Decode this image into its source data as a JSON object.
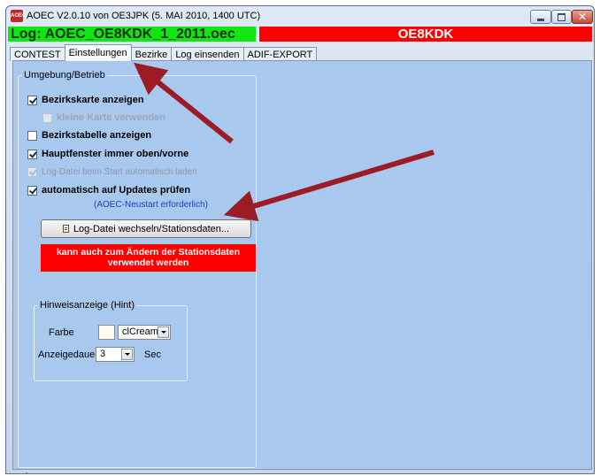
{
  "window": {
    "app_icon_text": "AOEC",
    "title": "AOEC V2.0.10 von OE3JPK (5. MAI 2010, 1400 UTC)",
    "close_glyph": "✕"
  },
  "header": {
    "log_label": "Log: AOEC_OE8KDK_1_2011.oec",
    "callsign": "OE8KDK"
  },
  "tabs": [
    {
      "label": "CONTEST"
    },
    {
      "label": "Einstellungen"
    },
    {
      "label": "Bezirke"
    },
    {
      "label": "Log einsenden"
    },
    {
      "label": "ADIF-EXPORT"
    }
  ],
  "environment": {
    "legend": "Umgebung/Betrieb",
    "options": [
      {
        "label": "Bezirkskarte anzeigen",
        "checked": true,
        "enabled": true
      },
      {
        "label": "kleine Karte verwenden",
        "checked": false,
        "enabled": false
      },
      {
        "label": "Bezirkstabelle anzeigen",
        "checked": false,
        "enabled": true
      },
      {
        "label": "Hauptfenster immer oben/vorne",
        "checked": true,
        "enabled": true
      },
      {
        "label": "Log-Datei beim Start automatisch laden",
        "checked": true,
        "enabled": false
      },
      {
        "label": "automatisch auf Updates prüfen",
        "checked": true,
        "enabled": true
      }
    ],
    "restart_note": "(AOEC-Neustart erforderlich)",
    "switch_button": "Log-Datei wechseln/Stationsdaten...",
    "red_note_line1": "kann auch zum Ändern der Stationsdaten",
    "red_note_line2": "verwendet werden"
  },
  "hint": {
    "legend": "Hinweisanzeige (Hint)",
    "color_label": "Farbe",
    "color_value": "clCream",
    "duration_label": "Anzeigedauer",
    "duration_value": "3",
    "duration_unit": "Sec"
  },
  "statusbar": {
    "text": "."
  },
  "colors": {
    "log_bar": "#12e612",
    "callsign_bar": "#ff0000",
    "panel_bg": "#a8c8ee",
    "annotation_arrow": "#9b1c24"
  }
}
